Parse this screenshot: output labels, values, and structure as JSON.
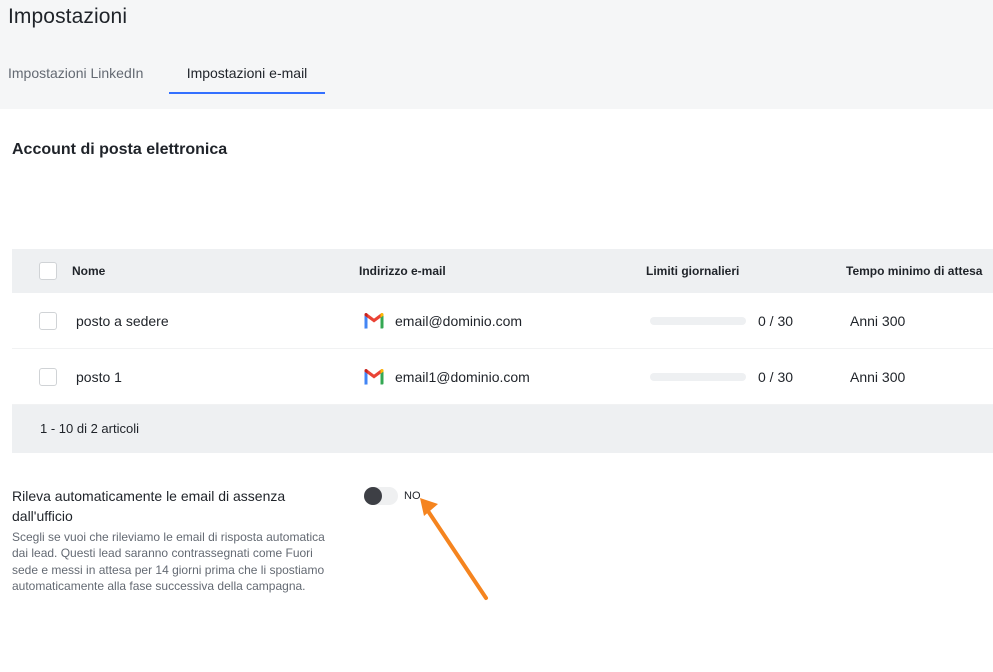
{
  "header": {
    "title": "Impostazioni",
    "tabs": [
      {
        "label": "Impostazioni LinkedIn",
        "active": false
      },
      {
        "label": "Impostazioni e-mail",
        "active": true
      }
    ]
  },
  "section": {
    "title": "Account di posta elettronica"
  },
  "table": {
    "columns": [
      "Nome",
      "Indirizzo e-mail",
      "Limiti giornalieri",
      "Tempo minimo di attesa"
    ],
    "rows": [
      {
        "name": "posto a sedere",
        "email": "email@dominio.com",
        "limit": "0 / 30",
        "limit_used": 0,
        "limit_max": 30,
        "wait": "Anni 300"
      },
      {
        "name": "posto 1",
        "email": "email1@dominio.com",
        "limit": "0 / 30",
        "limit_used": 0,
        "limit_max": 30,
        "wait": "Anni 300"
      }
    ],
    "pagination": "1 - 10 di 2 articoli"
  },
  "out_of_office": {
    "label": "Rileva automaticamente le email di assenza dall'ufficio",
    "description": "Scegli se vuoi che rileviamo le email di risposta automatica dai lead. Questi lead saranno contrassegnati come Fuori sede e messi in attesa per 14 giorni prima che li spostiamo automaticamente alla fase successiva della campagna.",
    "toggle_state": "NO",
    "toggle_on": false
  },
  "colors": {
    "accent": "#3370ff",
    "annotation_arrow": "#f5841f",
    "header_bg": "#f5f6f7",
    "table_header_bg": "#eef0f2"
  },
  "icons": {
    "mail_provider": "gmail-icon"
  }
}
